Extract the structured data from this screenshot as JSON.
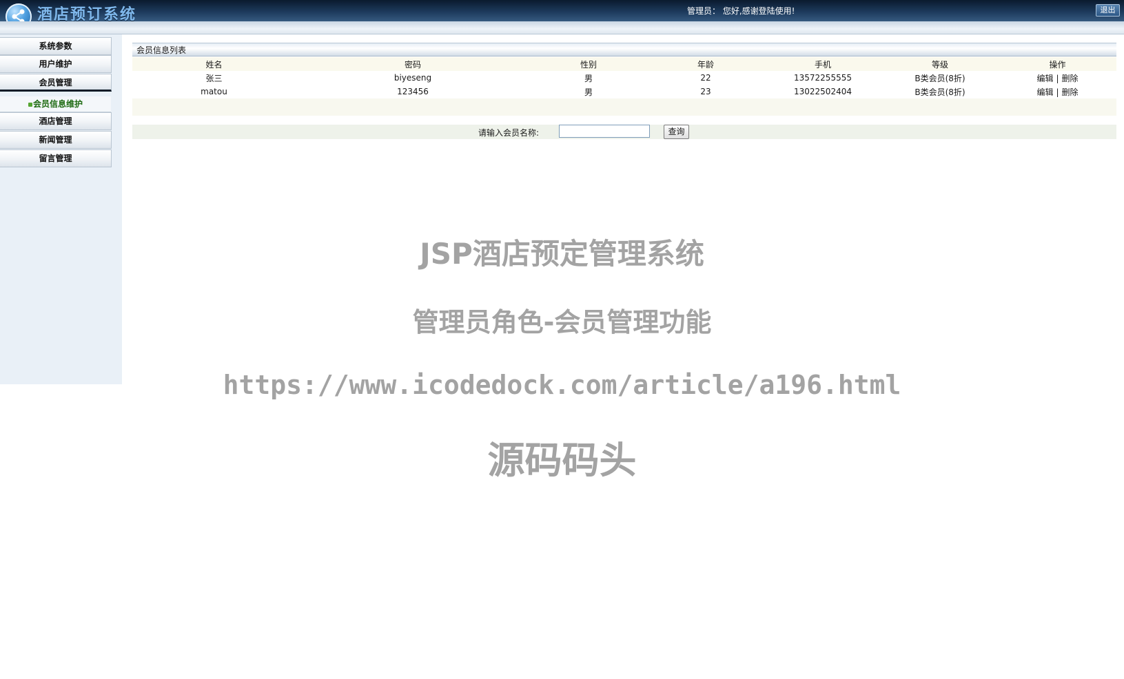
{
  "header": {
    "app_title": "酒店预订系统",
    "welcome": "管理员：  您好,感谢登陆使用!",
    "logout_label": "退出"
  },
  "sidebar": {
    "items": [
      {
        "label": "系统参数"
      },
      {
        "label": "用户维护"
      },
      {
        "label": "会员管理"
      },
      {
        "label": "酒店管理"
      },
      {
        "label": "新闻管理"
      },
      {
        "label": "留言管理"
      }
    ],
    "submenu": {
      "label": "会员信息维护"
    }
  },
  "main": {
    "panel_title": "会员信息列表",
    "table": {
      "columns": [
        "姓名",
        "密码",
        "性别",
        "年龄",
        "手机",
        "等级",
        "操作"
      ],
      "rows": [
        {
          "name": "张三",
          "password": "biyeseng",
          "gender": "男",
          "age": "22",
          "phone": "13572255555",
          "level": "B类会员(8折)",
          "edit": "编辑",
          "delete": "删除"
        },
        {
          "name": "matou",
          "password": "123456",
          "gender": "男",
          "age": "23",
          "phone": "13022502404",
          "level": "B类会员(8折)",
          "edit": "编辑",
          "delete": "删除"
        }
      ],
      "action_separator": "|"
    },
    "search": {
      "label": "请输入会员名称:",
      "value": "",
      "button_label": "查询"
    }
  },
  "watermark": {
    "line1": "JSP酒店预定管理系统",
    "line2": "管理员角色-会员管理功能",
    "line3": "https://www.icodedock.com/article/a196.html",
    "line4": "源码码头"
  }
}
